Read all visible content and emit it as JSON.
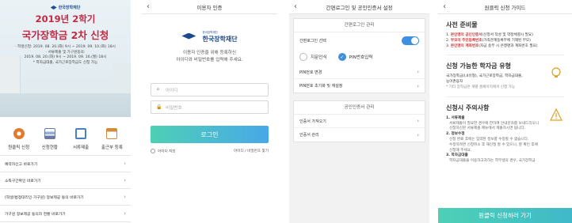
{
  "screen1": {
    "banner": {
      "logo": "한국장학재단",
      "title1": "2019년 2학기",
      "title2": "국가장학금 2차 신청",
      "info": [
        "· 학생신청: 2019. 08. 20.(화) 9시 ~ 2019. 09. 10.(화) 18시",
        "· 서류제출 및 가구원동의:",
        "2019. 08. 20.(화) 9시 ~ 2019. 09. 16.(월) 18시",
        "* 학자금대출, 국가근로장학금도 신청 가능"
      ]
    },
    "quick": [
      {
        "label": "원클릭 신청",
        "icon": "gear-icon",
        "color": "#e27b2e"
      },
      {
        "label": "신청현황",
        "icon": "chart-icon",
        "color": "#6b7aa1"
      },
      {
        "label": "서류제출",
        "icon": "document-icon",
        "color": "#4a7fc1"
      },
      {
        "label": "출근부 등록",
        "icon": "calendar-icon",
        "color": "#d48a3a"
      }
    ],
    "menu": [
      "예약자신고 바로가기",
      "소득구간확인 바로가기",
      "(학생/법정대리인·가구원) 정보제공 동의 바로가기",
      "가구원 정보제공 동의자 현황 바로가기"
    ]
  },
  "screen2": {
    "title": "이용자 인증",
    "logo_small": "한국장학재단",
    "logo_big": "한국장학재단",
    "desc1": "이용자 인증을 위해 등록하신",
    "desc2": "아이디와 비밀번호를 입력해 주세요.",
    "id_placeholder": "아이디",
    "pw_placeholder": "비밀번호",
    "login": "로그인",
    "save_id": "아이디 저장",
    "find": "아이디 / 비밀번호 찾기"
  },
  "screen3": {
    "title": "간편로그인 및 공인인증서 설정",
    "card1_title": "간편로그인 관리",
    "select_label": "간편로그인 선택",
    "opt_finger": "지문인식",
    "opt_pin": "PIN번호입력",
    "pin_change": "PIN번호 변경",
    "pin_reset": "PIN번호 초기화 및 재설정",
    "card2_title": "공인인증서 관리",
    "cert_import": "인증서 가져오기",
    "cert_manage": "인증서 관리"
  },
  "screen4": {
    "title": "원클릭 신청 가이드",
    "sec1_title": "사전 준비물",
    "sec1_items": [
      {
        "n": "1.",
        "red": "본인명의 공인인증서",
        "rest": "(신청서 작성 및 약정체결시 필요)"
      },
      {
        "n": "2.",
        "red": "부모의 주민등록번호",
        "rest": "(가족관계등록부에 기재된 부모)"
      },
      {
        "n": "3.",
        "red": "본인명의 계좌번호",
        "rest": "(자금 송부 시 은행명과 계좌번호 필요)"
      }
    ],
    "sec2_title": "신청 가능한 학자금 유형",
    "sec2_l1": "국가장학금(I,II유형), 국가근로장학금, 학자금대출,",
    "sec2_l2": "농어촌융자",
    "sec2_l3": "* 기타 장학금은 개별 홈페이지에서 신청 가능",
    "sec3_title": "신청시 주의사항",
    "sec3_lines": [
      {
        "t": "1. 서류제출",
        "b": true
      },
      {
        "t": "서류제출이 필요한 경우에 한하여 안내문자를 보내드리오니",
        "b": false
      },
      {
        "t": "신청하신분 서류제출 메뉴에서 제출하시면 됩니다.",
        "b": false
      },
      {
        "t": "2. 정보수정",
        "b": true
      },
      {
        "t": "신청 완료 후에는 입력된 정보를 수정할 수 없습니다.",
        "b": false
      },
      {
        "t": "수정하려면 신청취소 후 재신청 할 수 있으니, 잘 확인 후에",
        "b": false
      },
      {
        "t": "신청해 주세요.",
        "b": false
      },
      {
        "t": "3. 학자금대출",
        "b": true
      },
      {
        "t": "학자금대출을 이용하고자하는 학부생의 경우, 국가장학금",
        "b": false
      }
    ],
    "apply": "원클릭 신청하러 가기"
  }
}
